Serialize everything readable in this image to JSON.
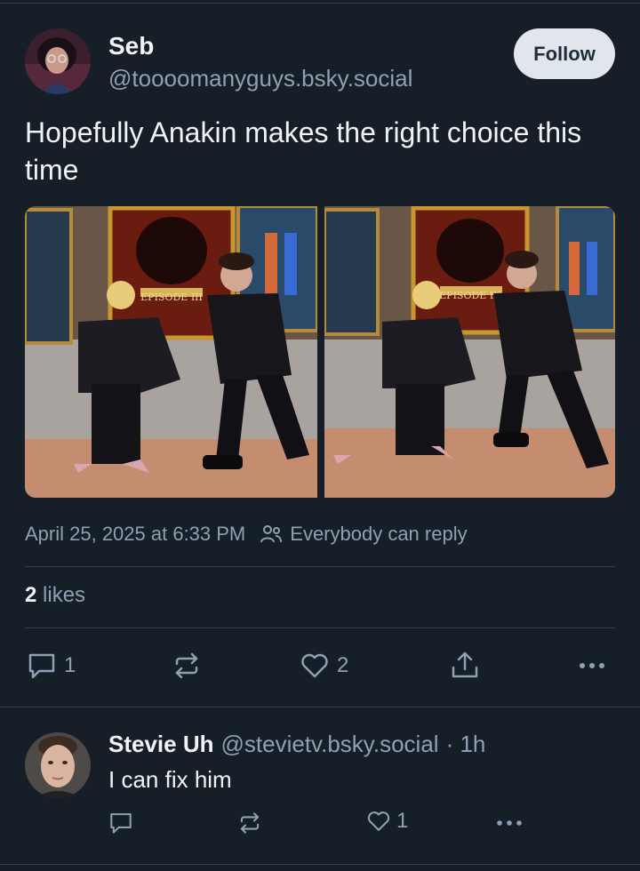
{
  "post": {
    "author_name": "Seb",
    "author_handle": "@toooomanyguys.bsky.social",
    "follow_label": "Follow",
    "text": "Hopefully Anakin makes the right choice this time",
    "timestamp": "April 25, 2025 at 6:33 PM",
    "reply_setting": "Everybody can reply",
    "likes_count": "2",
    "likes_label": "likes",
    "images": [
      {
        "poster_title": "EPISODE III"
      },
      {
        "poster_title": "EPISODE III"
      }
    ],
    "actions": {
      "reply_count": "1",
      "repost_count": "",
      "like_count": "2"
    }
  },
  "reply": {
    "author_name": "Stevie Uh",
    "author_handle": "@stevietv.bsky.social",
    "time": "· 1h",
    "text": "I can fix him",
    "actions": {
      "like_count": "1"
    }
  },
  "colors": {
    "background": "#161e27",
    "muted_text": "#8ea0b3",
    "follow_button_bg": "#e0e6ec"
  }
}
